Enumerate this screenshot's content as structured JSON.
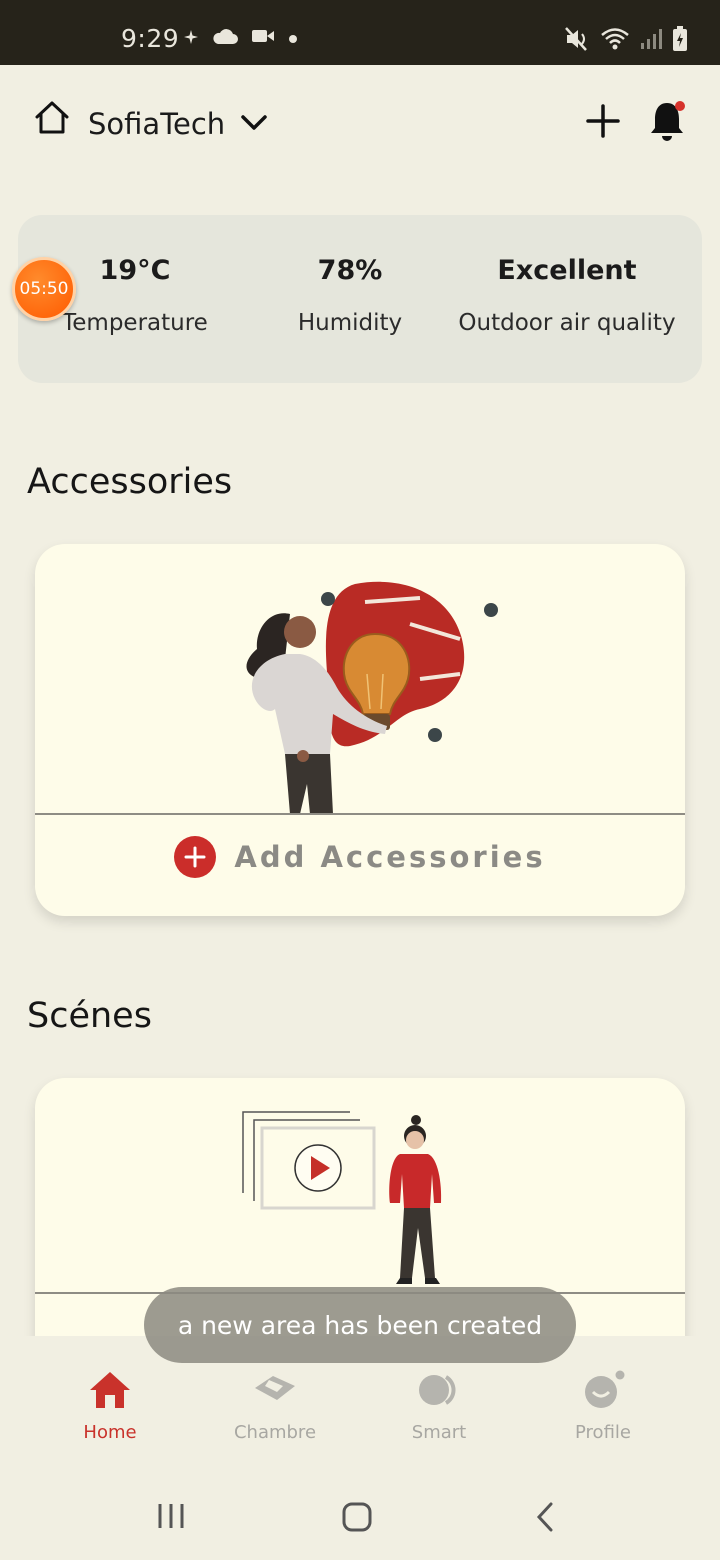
{
  "status_bar": {
    "time": "9:29",
    "icons": [
      "sparkle-icon",
      "cloud-icon",
      "video-icon",
      "dot-icon",
      "mute-icon",
      "wifi-icon",
      "signal-icon",
      "battery-icon"
    ]
  },
  "header": {
    "home_name": "SofiaTech",
    "icons": [
      "home-outline-icon",
      "chevron-down-icon",
      "plus-icon",
      "bell-icon"
    ],
    "notification_color": "#d6322b"
  },
  "timer_badge": {
    "text": "05:50",
    "color": "#ff6a10"
  },
  "climate": [
    {
      "value": "19°C",
      "label": "Temperature"
    },
    {
      "value": "78%",
      "label": "Humidity"
    },
    {
      "value": "Excellent",
      "label": "Outdoor air quality"
    }
  ],
  "accessories": {
    "title": "Accessories",
    "add_label": "Add Accessories"
  },
  "scenes": {
    "title": "Scénes"
  },
  "toast": {
    "text": "a new area has been created"
  },
  "bottom_nav": {
    "items": [
      {
        "label": "Home",
        "icon": "home-icon",
        "active": true
      },
      {
        "label": "Chambre",
        "icon": "room-icon",
        "active": false
      },
      {
        "label": "Smart",
        "icon": "smart-icon",
        "active": false
      },
      {
        "label": "Profile",
        "icon": "profile-icon",
        "active": false
      }
    ]
  },
  "system_nav": {
    "icons": [
      "recents-icon",
      "home-button-icon",
      "back-icon"
    ]
  },
  "colors": {
    "accent": "#cb2d2a",
    "background": "#f1efe2",
    "card": "#fefce9"
  }
}
